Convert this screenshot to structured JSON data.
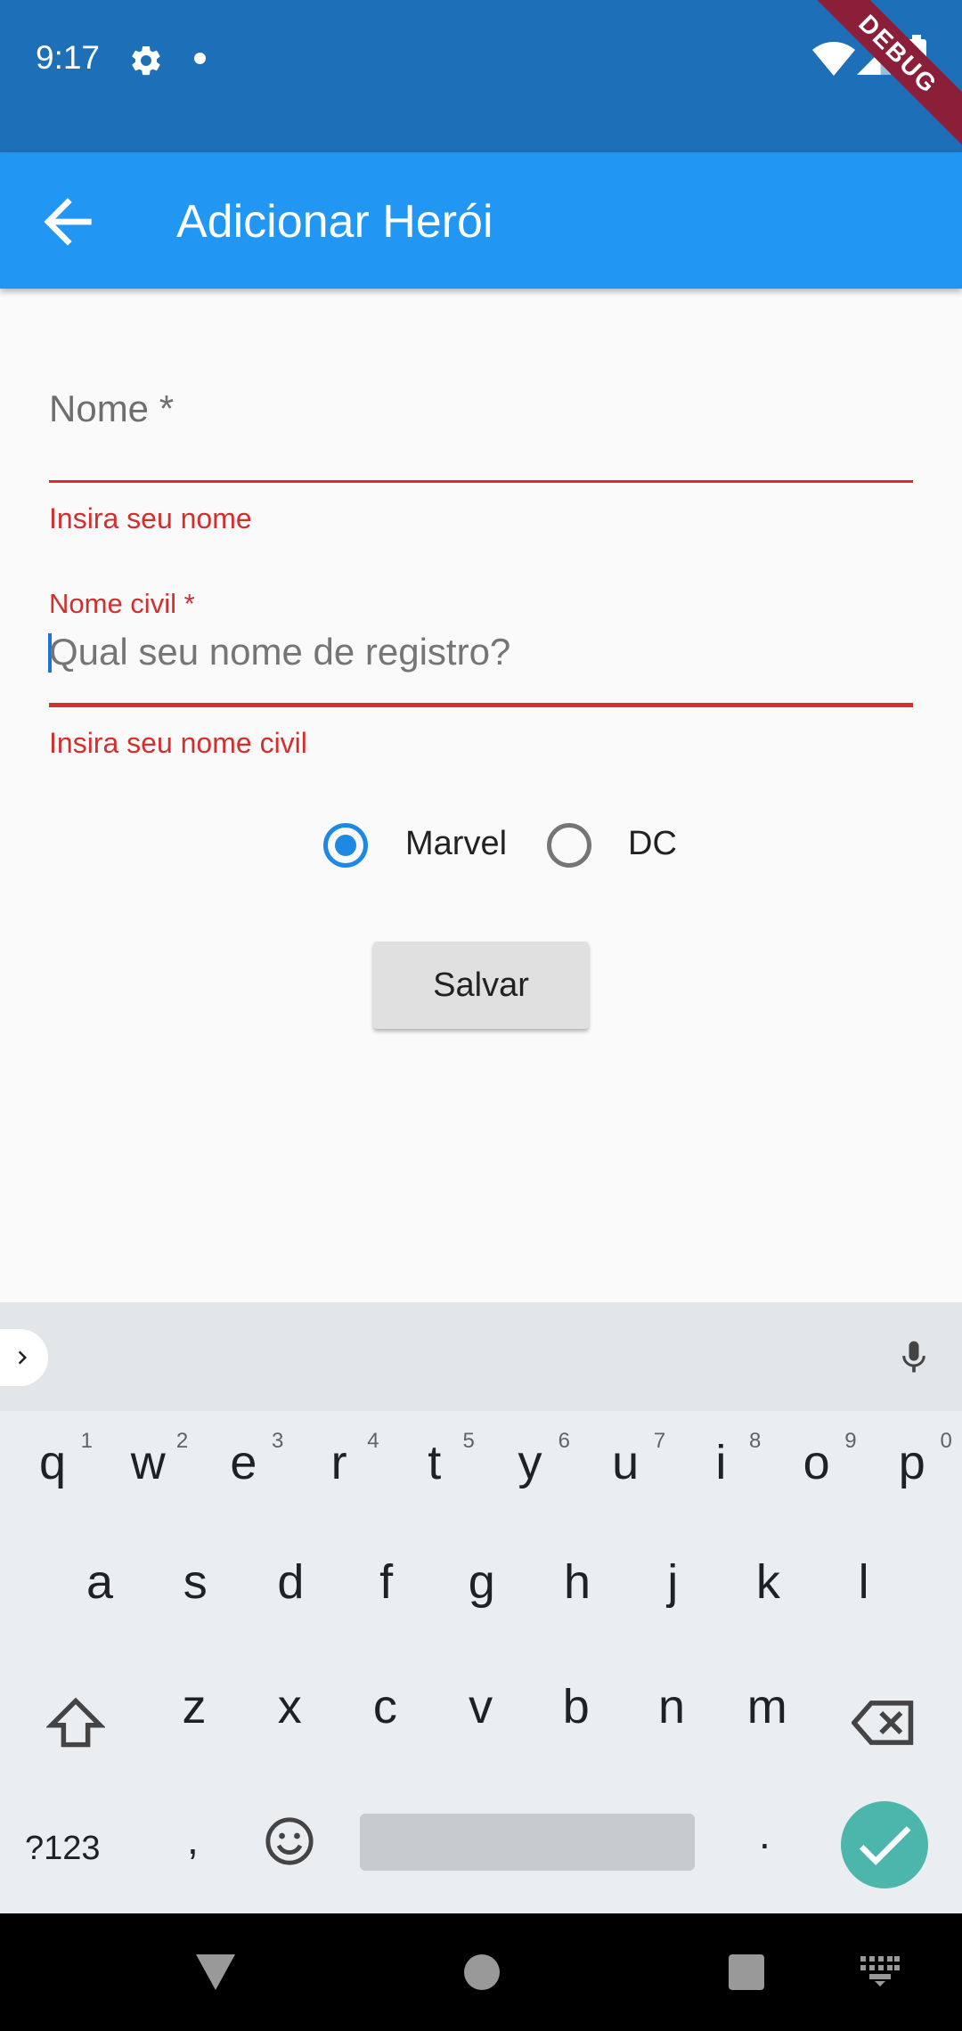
{
  "status_bar": {
    "time": "9:17",
    "debug_banner": "DEBUG"
  },
  "app_bar": {
    "title": "Adicionar Herói"
  },
  "form": {
    "name_field": {
      "label": "Nome *",
      "error": "Insira seu nome"
    },
    "civil_name_field": {
      "label": "Nome civil *",
      "placeholder": "Qual seu nome de registro?",
      "error": "Insira seu nome civil"
    },
    "publisher": {
      "options": [
        {
          "label": "Marvel",
          "selected": true
        },
        {
          "label": "DC",
          "selected": false
        }
      ]
    },
    "save_label": "Salvar"
  },
  "keyboard": {
    "row1": [
      {
        "ch": "q",
        "hint": "1"
      },
      {
        "ch": "w",
        "hint": "2"
      },
      {
        "ch": "e",
        "hint": "3"
      },
      {
        "ch": "r",
        "hint": "4"
      },
      {
        "ch": "t",
        "hint": "5"
      },
      {
        "ch": "y",
        "hint": "6"
      },
      {
        "ch": "u",
        "hint": "7"
      },
      {
        "ch": "i",
        "hint": "8"
      },
      {
        "ch": "o",
        "hint": "9"
      },
      {
        "ch": "p",
        "hint": "0"
      }
    ],
    "row2": [
      "a",
      "s",
      "d",
      "f",
      "g",
      "h",
      "j",
      "k",
      "l"
    ],
    "row3": [
      "z",
      "x",
      "c",
      "v",
      "b",
      "n",
      "m"
    ],
    "symbols_label": "?123",
    "comma": ",",
    "period": "."
  },
  "colors": {
    "primary": "#2196f3",
    "status_bar": "#1d70b8",
    "error": "#d32f2f",
    "radio_active": "#1e88e5",
    "enter_key": "#4db6ac"
  }
}
